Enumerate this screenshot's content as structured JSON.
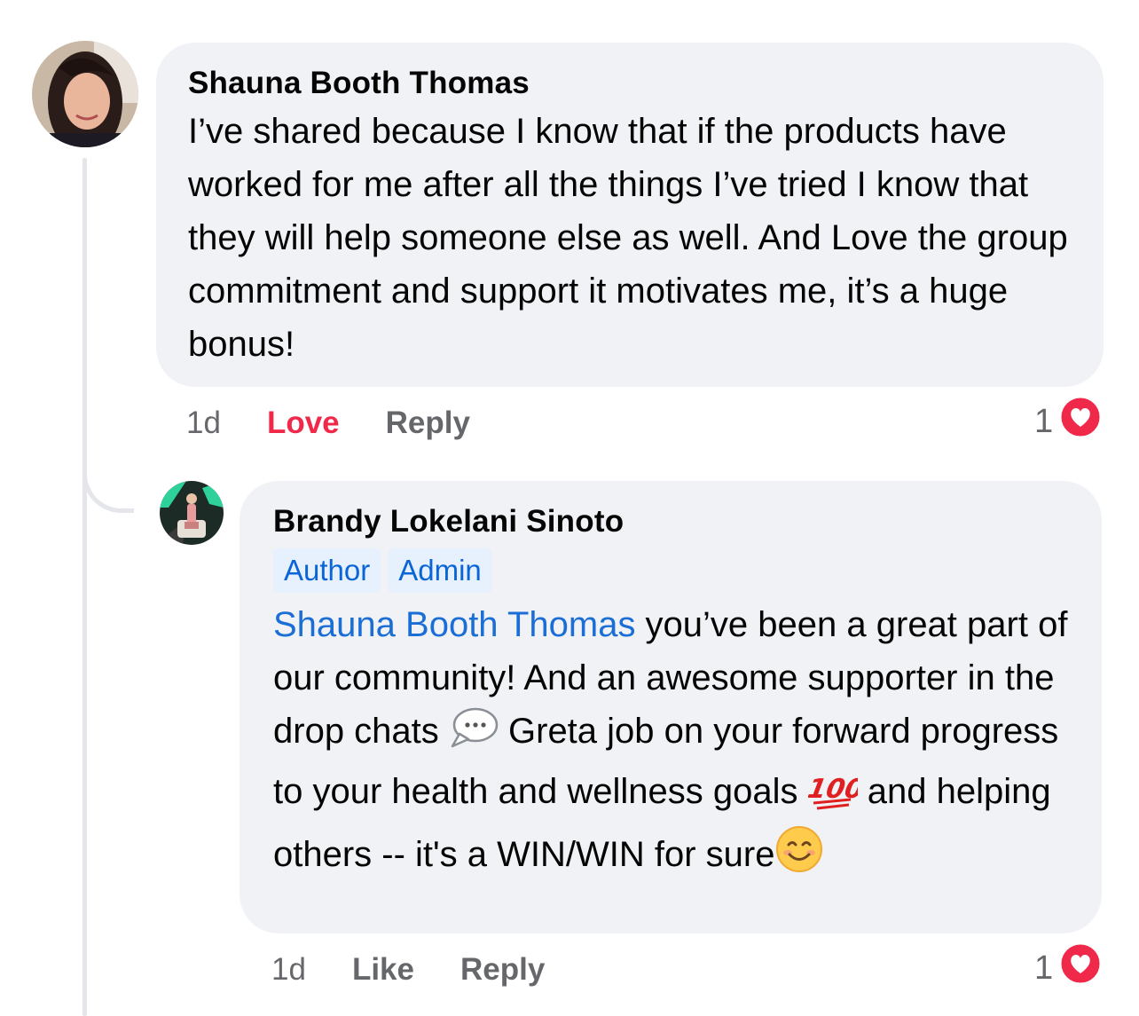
{
  "comments": [
    {
      "author": "Shauna Booth Thomas",
      "text": "I’ve shared because I know that if the products have worked for me after all the things I’ve tried I know that they will help someone else as well. And Love the group commitment and support it motivates me, it’s a huge bonus!",
      "time": "1d",
      "reaction_label": "Love",
      "reply_label": "Reply",
      "reaction_count": "1",
      "reaction_icon": "heart-icon"
    },
    {
      "author": "Brandy Lokelani Sinoto",
      "badges": [
        "Author",
        "Admin"
      ],
      "mention": "Shauna Booth Thomas",
      "text_part1": " you’ve been a great part of our community! And an awesome supporter in the drop chats ",
      "text_part2": " Greta job on your forward progress to your health and wellness goals ",
      "text_part3": " and helping others -- it's a WIN/WIN for sure",
      "time": "1d",
      "reaction_label": "Like",
      "reply_label": "Reply",
      "reaction_count": "1",
      "reaction_icon": "heart-icon"
    }
  ],
  "colors": {
    "bubble": "#f0f2f5",
    "love": "#f0284a",
    "mention": "#1b6ed6",
    "badge_bg": "#e7f0fd",
    "meta": "#65676b"
  }
}
